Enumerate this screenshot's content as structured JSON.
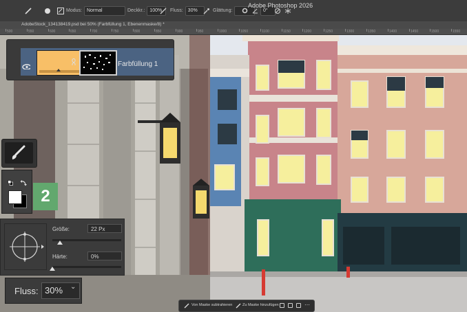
{
  "app": {
    "title": "Adobe Photoshop 2026"
  },
  "options_bar": {
    "mode_label": "Modus:",
    "mode_value": "Normal",
    "opacity_label": "Deckkr.:",
    "opacity_value": "100%",
    "flow_label": "Fluss:",
    "flow_value": "30%",
    "smoothing_label": "Glättung:",
    "angle_value": "0°"
  },
  "document_tab": {
    "title": "AdobeStock_134138419.psd bei 50% (Farbfüllung 1, Ebenenmaske/8) *"
  },
  "ruler": {
    "ticks": [
      "500",
      "550",
      "600",
      "650",
      "700",
      "750",
      "800",
      "850",
      "900",
      "950",
      "1000",
      "1050",
      "1100",
      "1150",
      "1200",
      "1250",
      "1300",
      "1350",
      "1400",
      "1450",
      "1500",
      "1550"
    ]
  },
  "layers_panel": {
    "layer_name": "Farbfüllung 1",
    "fill_color": "#f8bf67",
    "row_color": "#4b6382"
  },
  "toolbar": {
    "active_tool_icon": "brush-icon",
    "foreground_color": "#ffffff",
    "background_color": "#000000"
  },
  "step_badge": {
    "number": "2",
    "color": "#62a86e"
  },
  "brush_panel": {
    "size_label": "Größe:",
    "size_value": "22 Px",
    "hardness_label": "Härte:",
    "hardness_value": "0%"
  },
  "flow_callout": {
    "label": "Fluss:",
    "value": "30%"
  },
  "context_bar": {
    "subtract_label": "Von Maske subtrahieren",
    "add_label": "Zu Maske hinzufügen"
  }
}
